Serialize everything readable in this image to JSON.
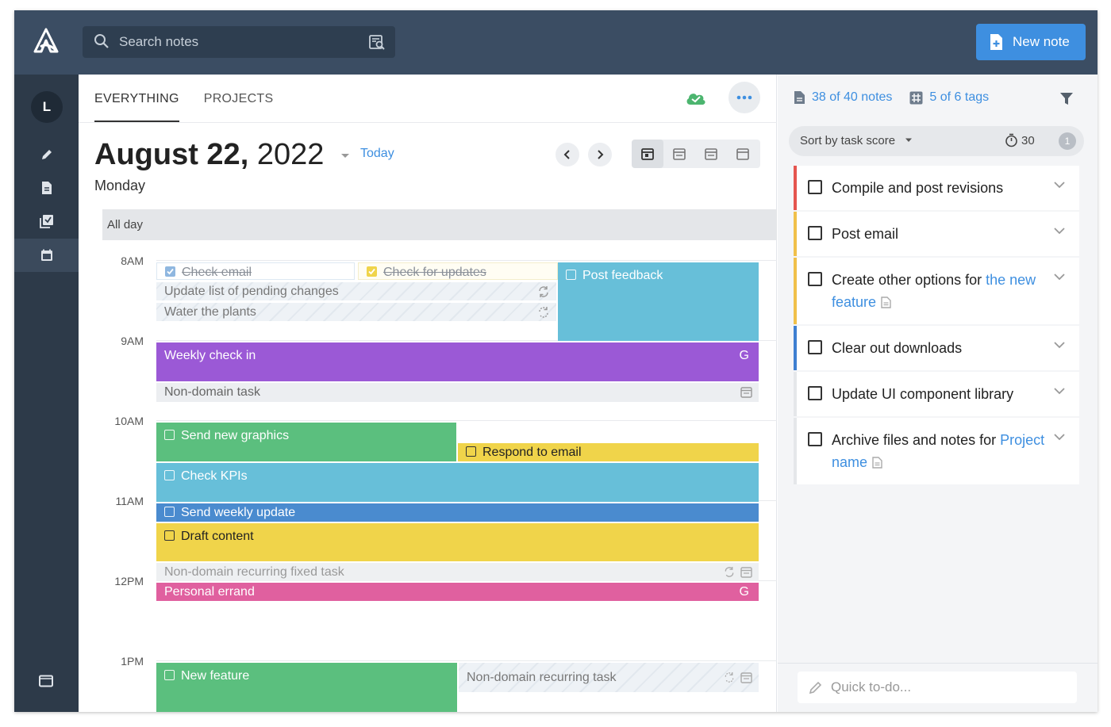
{
  "topbar": {
    "search_placeholder": "Search notes",
    "new_note_label": "New note"
  },
  "rail": {
    "avatar_initial": "L"
  },
  "tabs": [
    {
      "label": "EVERYTHING",
      "active": true
    },
    {
      "label": "PROJECTS",
      "active": false
    }
  ],
  "calendar": {
    "date_bold": "August 22,",
    "date_year": "2022",
    "weekday": "Monday",
    "today_label": "Today",
    "allday_label": "All day",
    "hours": [
      "8AM",
      "9AM",
      "10AM",
      "11AM",
      "12PM",
      "1PM"
    ],
    "events": {
      "check_email": "Check email",
      "check_updates": "Check for updates",
      "update_list": "Update list of pending changes",
      "water_plants": "Water the plants",
      "post_feedback": "Post feedback",
      "weekly_checkin": "Weekly check in",
      "weekly_checkin_badge": "G",
      "non_domain_task": "Non-domain task",
      "send_graphics": "Send new graphics",
      "respond_email": "Respond to email",
      "check_kpis": "Check KPIs",
      "send_weekly_update": "Send weekly update",
      "draft_content": "Draft content",
      "non_domain_recurring_fixed": "Non-domain recurring fixed task",
      "personal_errand": "Personal errand",
      "personal_errand_badge": "G",
      "new_feature": "New feature",
      "non_domain_recurring": "Non-domain recurring task"
    }
  },
  "right": {
    "notes_count": "38 of 40 notes",
    "tags_count": "5 of 6 tags",
    "sort_label": "Sort by task score",
    "timer_value": "30",
    "badge_value": "1",
    "tasks": [
      {
        "text": "Compile and post revisions",
        "color": "#e5554f"
      },
      {
        "text": "Post email",
        "color": "#f0c04a"
      },
      {
        "text": "Create other options for ",
        "link": "the new feature",
        "color": "#f0c04a"
      },
      {
        "text": "Clear out downloads",
        "color": "#3e7fd1"
      },
      {
        "text": "Update UI component library",
        "color": "#e5e7ea"
      },
      {
        "text": "Archive files and notes for ",
        "link": "Project name",
        "color": "#e5e7ea"
      }
    ],
    "quick_placeholder": "Quick to-do..."
  },
  "colors": {
    "topbar": "#3b4d63",
    "rail": "#2d3a49",
    "accent": "#3e8fe0",
    "purple": "#9b59d6",
    "green": "#5bbf7e",
    "cyan": "#67bfd9",
    "yellow": "#f0d44a",
    "blue": "#4a8bcf",
    "pink": "#e0609f"
  }
}
